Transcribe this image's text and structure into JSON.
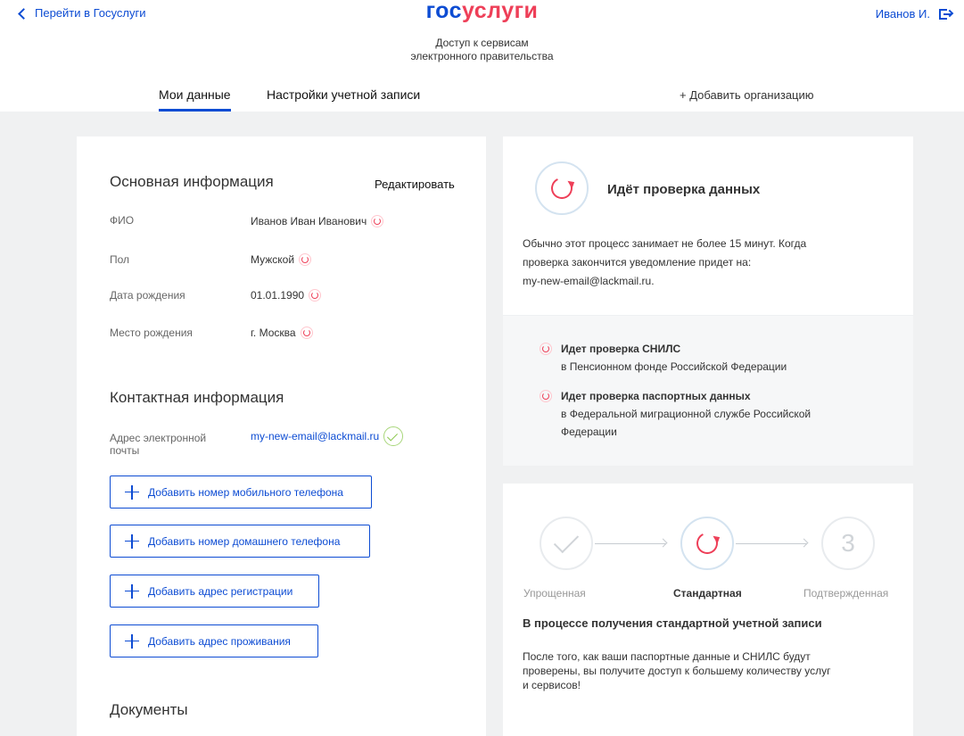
{
  "header": {
    "back_link": "Перейти в Госуслуги",
    "logo_part1": "гос",
    "logo_part2": "услуги",
    "tagline_line1": "Доступ к сервисам",
    "tagline_line2": "электронного правительства",
    "user_name": "Иванов И."
  },
  "tabs": [
    {
      "label": "Мои данные",
      "active": true
    },
    {
      "label": "Настройки учетной записи",
      "active": false
    }
  ],
  "add_org": "+ Добавить организацию",
  "basic_info": {
    "title": "Основная информация",
    "edit_label": "Редактировать",
    "fields": [
      {
        "label": "ФИО",
        "value": "Иванов Иван Иванович"
      },
      {
        "label": "Пол",
        "value": "Мужской"
      },
      {
        "label": "Дата рождения",
        "value": "01.01.1990"
      },
      {
        "label": "Место рождения",
        "value": "г. Москва"
      }
    ]
  },
  "contact_info": {
    "title": "Контактная информация",
    "email_label_line1": "Адрес электронной",
    "email_label_line2": "почты",
    "email_value": "my-new-email@lackmail.ru",
    "buttons": [
      "Добавить номер мобильного телефона",
      "Добавить номер домашнего телефона",
      "Добавить адрес регистрации",
      "Добавить адрес проживания"
    ]
  },
  "documents": {
    "title": "Документы"
  },
  "status": {
    "title": "Идёт проверка данных",
    "text_line1": "Обычно этот процесс занимает не более 15 минут. Когда",
    "text_line2": "проверка закончится уведомление придет на:",
    "text_line3": "my-new-email@lackmail.ru.",
    "checks": [
      {
        "title": "Идет проверка СНИЛС",
        "line1": "в Пенсионном фонде Российской Федерации",
        "line2": ""
      },
      {
        "title": "Идет проверка паспортных данных",
        "line1": "в Федеральной миграционной службе Российской",
        "line2": "Федерации"
      }
    ]
  },
  "steps": {
    "items": [
      {
        "label": "Упрощенная",
        "state": "done"
      },
      {
        "label": "Стандартная",
        "state": "active"
      },
      {
        "label": "Подтвержденная",
        "state": "pending",
        "number": "3"
      }
    ],
    "heading": "В процессе получения стандартной учетной записи",
    "text_line1": "После того, как ваши паспортные данные и СНИЛС будут",
    "text_line2": "проверены, вы получите доступ к большему количеству услуг",
    "text_line3": "и сервисов!"
  },
  "colors": {
    "brand_blue": "#0d4cd3",
    "brand_red": "#ee3f58",
    "success_green": "#8cc850"
  }
}
